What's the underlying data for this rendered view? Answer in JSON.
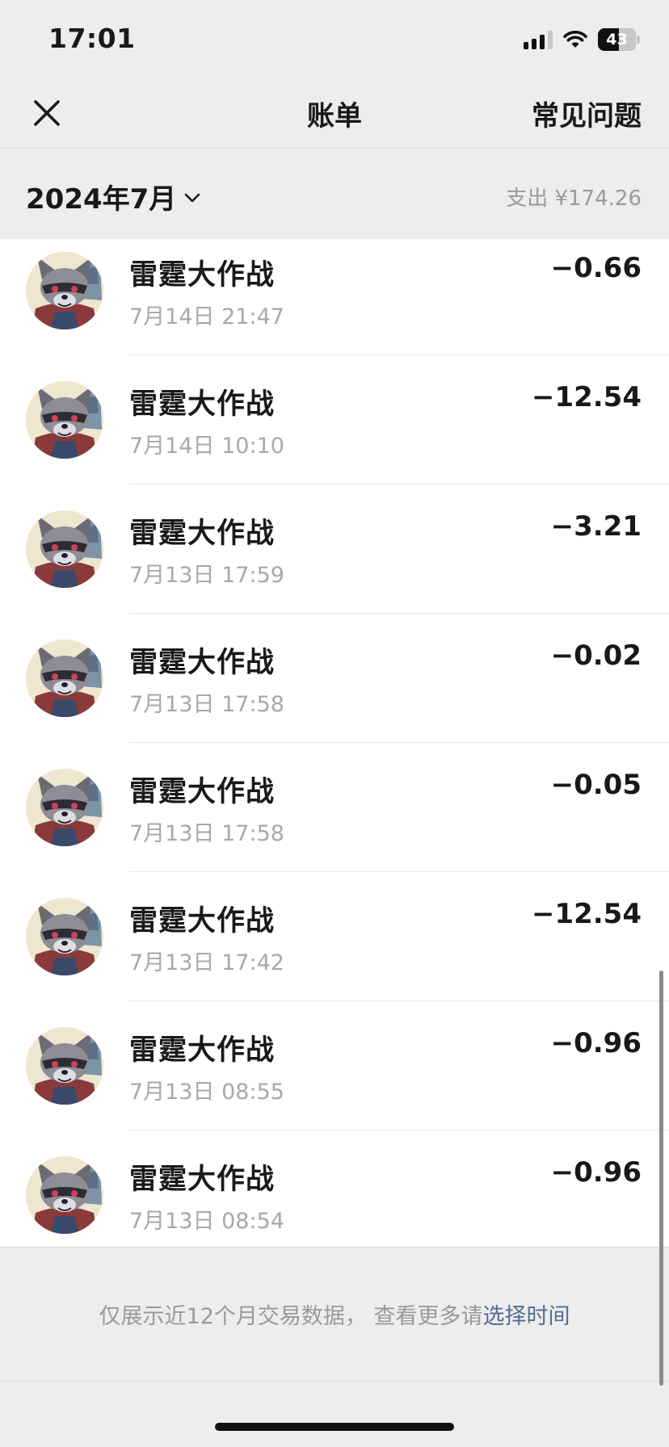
{
  "status_bar": {
    "time": "17:01",
    "battery": "43",
    "icons": [
      "cellular-signal-icon",
      "wifi-icon",
      "battery-icon"
    ]
  },
  "nav": {
    "close_icon": "close-icon",
    "title": "账单",
    "faq_label": "常见问题"
  },
  "month_header": {
    "label": "2024年7月",
    "chevron_icon": "chevron-down-icon",
    "summary": "支出 ¥174.26"
  },
  "transactions": [
    {
      "title": "雷霆大作战",
      "time": "7月14日 21:47",
      "amount": "−0.66"
    },
    {
      "title": "雷霆大作战",
      "time": "7月14日 10:10",
      "amount": "−12.54"
    },
    {
      "title": "雷霆大作战",
      "time": "7月13日 17:59",
      "amount": "−3.21"
    },
    {
      "title": "雷霆大作战",
      "time": "7月13日 17:58",
      "amount": "−0.02"
    },
    {
      "title": "雷霆大作战",
      "time": "7月13日 17:58",
      "amount": "−0.05"
    },
    {
      "title": "雷霆大作战",
      "time": "7月13日 17:42",
      "amount": "−12.54"
    },
    {
      "title": "雷霆大作战",
      "time": "7月13日 08:55",
      "amount": "−0.96"
    },
    {
      "title": "雷霆大作战",
      "time": "7月13日 08:54",
      "amount": "−0.96"
    }
  ],
  "footer": {
    "note": "仅展示近12个月交易数据， 查看更多请",
    "link": "选择时间"
  },
  "colors": {
    "background": "#ededed",
    "link": "#576b95",
    "secondary_text": "#a8a8a8"
  }
}
